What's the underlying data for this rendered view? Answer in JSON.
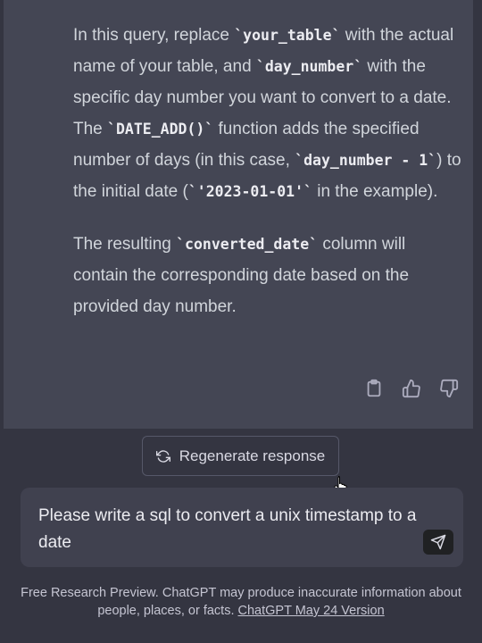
{
  "message": {
    "p1": {
      "t1": "In this query, replace ",
      "c1": "`your_table`",
      "t2": " with the actual name of your table, and ",
      "c2": "`day_number`",
      "t3": " with the specific day number you want to convert to a date. The ",
      "c3": "`DATE_ADD()`",
      "t4": " function adds the specified number of days (in this case, ",
      "c4": "`day_number - 1`",
      "t5": ") to the initial date (",
      "c5": "`'2023-01-01'`",
      "t6": " in the example)."
    },
    "p2": {
      "t1": "The resulting ",
      "c1": "`converted_date`",
      "t2": " column will contain the corresponding date based on the provided day number."
    }
  },
  "actions": {
    "copy_icon": "clipboard-icon",
    "like_icon": "thumbs-up-icon",
    "dislike_icon": "thumbs-down-icon"
  },
  "regenerate": {
    "label": "Regenerate response",
    "icon": "refresh-icon"
  },
  "input": {
    "value": "Please write a sql to convert a unix timestamp to a date",
    "send_icon": "send-icon"
  },
  "footer": {
    "text": "Free Research Preview. ChatGPT may produce inaccurate information about people, places, or facts. ",
    "link": "ChatGPT May 24 Version"
  },
  "colors": {
    "background": "#343541",
    "message_bg": "#444654",
    "input_bg": "#40414f"
  }
}
